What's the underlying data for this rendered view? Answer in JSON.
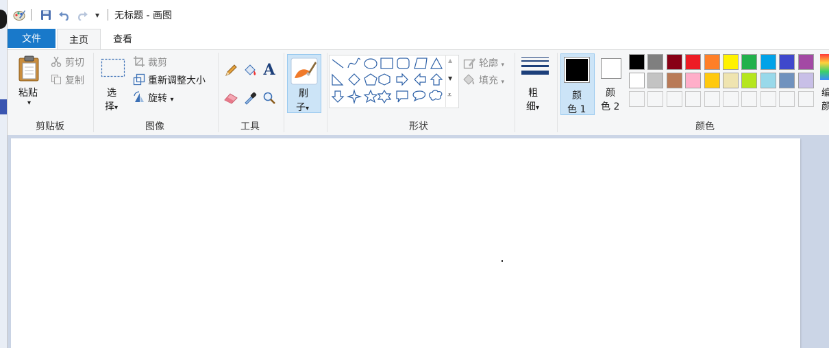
{
  "window": {
    "title": "无标题 - 画图",
    "qat_more": "▾"
  },
  "tabs": [
    {
      "label": "文件"
    },
    {
      "label": "主页"
    },
    {
      "label": "查看"
    }
  ],
  "clipboard": {
    "paste": "粘贴",
    "paste_arrow": "▾",
    "cut": "剪切",
    "copy": "复制",
    "group": "剪贴板"
  },
  "image": {
    "select_1": "选",
    "select_2": "择",
    "crop": "裁剪",
    "resize": "重新调整大小",
    "rotate": "旋转",
    "group": "图像"
  },
  "tools": {
    "group": "工具"
  },
  "brushes": {
    "label_1": "刷",
    "label_2": "子"
  },
  "shapes": {
    "outline": "轮廓",
    "fill": "填充",
    "group": "形状"
  },
  "size": {
    "label_1": "粗",
    "label_2": "细"
  },
  "colors": {
    "color1_1": "颜",
    "color1_2": "色 1",
    "color2_1": "颜",
    "color2_2": "色 2",
    "edit_1": "编",
    "edit_2": "颜",
    "group": "颜色",
    "color1": "#000000",
    "color2": "#ffffff",
    "palette_row1": [
      "#000000",
      "#7f7f7f",
      "#880015",
      "#ed1c24",
      "#ff7f27",
      "#fff200",
      "#22b14c",
      "#00a2e8",
      "#3f48cc",
      "#a349a4"
    ],
    "palette_row2": [
      "#ffffff",
      "#c3c3c3",
      "#b97a57",
      "#ffaec9",
      "#ffc90e",
      "#efe4b0",
      "#b5e61d",
      "#99d9ea",
      "#7092be",
      "#c8bfe7"
    ],
    "palette_row3": [
      "#f5f6f7",
      "#f5f6f7",
      "#f5f6f7",
      "#f5f6f7",
      "#f5f6f7",
      "#f5f6f7",
      "#f5f6f7",
      "#f5f6f7",
      "#f5f6f7",
      "#f5f6f7"
    ]
  }
}
